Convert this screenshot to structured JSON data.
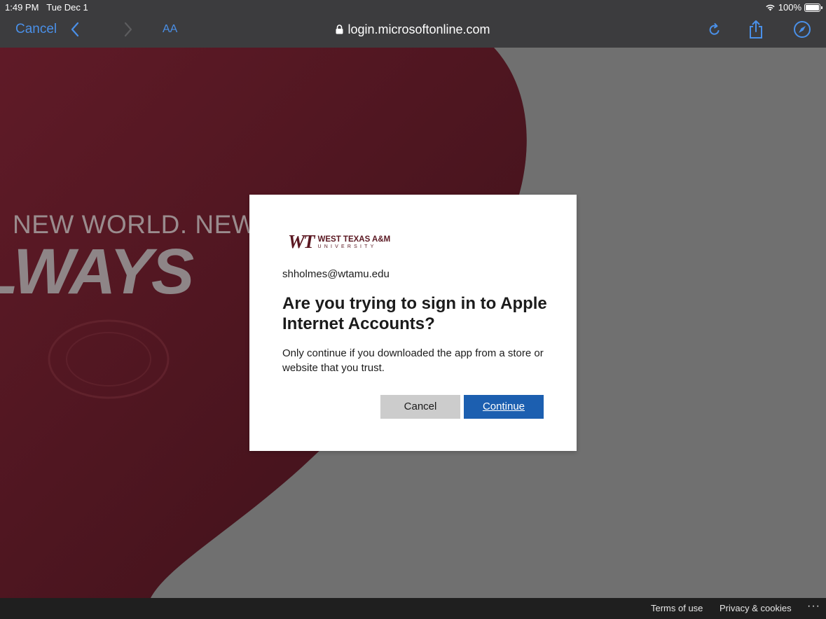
{
  "status_bar": {
    "time": "1:49 PM",
    "date": "Tue Dec 1",
    "battery": "100%"
  },
  "browser": {
    "cancel_label": "Cancel",
    "text_size_label": "AA",
    "url": "login.microsoftonline.com",
    "accent_color": "#4a90e8"
  },
  "background": {
    "tagline": "NEW WORLD. NEW WAY.",
    "big_word": "LWAYS",
    "brand_color": "#5a1721"
  },
  "dialog": {
    "logo_mark": "WT",
    "logo_name": "WEST TEXAS A&M",
    "logo_sub": "UNIVERSITY",
    "email": "shholmes@wtamu.edu",
    "heading": "Are you trying to sign in to Apple Internet Accounts?",
    "description": "Only continue if you downloaded the app from a store or website that you trust.",
    "cancel_label": "Cancel",
    "continue_label": "Continue",
    "primary_color": "#1c5fb0"
  },
  "footer": {
    "terms_label": "Terms of use",
    "privacy_label": "Privacy & cookies",
    "more_label": "···"
  }
}
